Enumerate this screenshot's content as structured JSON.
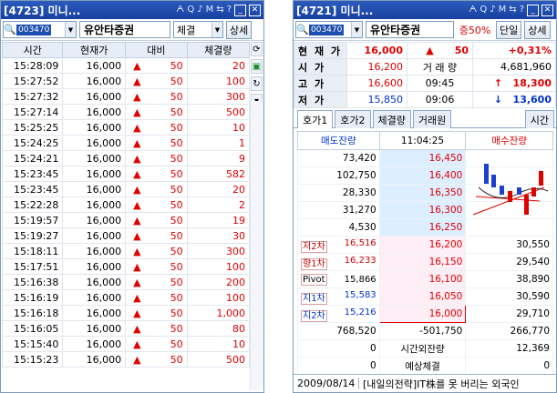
{
  "w1": {
    "title": "[4723] 미니...",
    "code": "003470",
    "name": "유안타증권",
    "type": "체결",
    "detail": "상세",
    "headers": [
      "시간",
      "현재가",
      "대비",
      "체결량"
    ],
    "rows": [
      [
        "15:28:09",
        "16,000",
        "50",
        "20"
      ],
      [
        "15:27:52",
        "16,000",
        "50",
        "100"
      ],
      [
        "15:27:32",
        "16,000",
        "50",
        "300"
      ],
      [
        "15:27:14",
        "16,000",
        "50",
        "500"
      ],
      [
        "15:25:25",
        "16,000",
        "50",
        "10"
      ],
      [
        "15:24:25",
        "16,000",
        "50",
        "1"
      ],
      [
        "15:24:21",
        "16,000",
        "50",
        "9"
      ],
      [
        "15:23:45",
        "16,000",
        "50",
        "582"
      ],
      [
        "15:23:45",
        "16,000",
        "50",
        "20"
      ],
      [
        "15:22:28",
        "16,000",
        "50",
        "2"
      ],
      [
        "15:19:57",
        "16,000",
        "50",
        "19"
      ],
      [
        "15:19:27",
        "16,000",
        "50",
        "30"
      ],
      [
        "15:18:11",
        "16,000",
        "50",
        "300"
      ],
      [
        "15:17:51",
        "16,000",
        "50",
        "100"
      ],
      [
        "15:16:38",
        "16,000",
        "50",
        "200"
      ],
      [
        "15:16:19",
        "16,000",
        "50",
        "100"
      ],
      [
        "15:16:18",
        "16,000",
        "50",
        "1,000"
      ],
      [
        "15:16:05",
        "16,000",
        "50",
        "80"
      ],
      [
        "15:15:40",
        "16,000",
        "50",
        "10"
      ],
      [
        "15:15:23",
        "16,000",
        "50",
        "500"
      ]
    ]
  },
  "w2": {
    "title": "[4721] 미니...",
    "code": "003470",
    "name": "유안타증권",
    "margin": "증50%",
    "unit": "단일",
    "detail": "상세",
    "quote": {
      "cur_label": "현 재 가",
      "cur": "16,000",
      "chg": "50",
      "pct": "+0,31%",
      "open_label": "시  가",
      "open": "16,200",
      "vol_label": "거 래 량",
      "vol": "4,681,960",
      "high_label": "고  가",
      "high": "16,600",
      "high_t": "09:45",
      "high_p": "18,300",
      "low_label": "저  가",
      "low": "15,850",
      "low_t": "09:06",
      "low_p": "13,600"
    },
    "tabs": [
      "호가1",
      "호가2",
      "체결량",
      "거래원"
    ],
    "time_tab": "시간",
    "ob": {
      "sell_h": "매도잔량",
      "time": "11:04:25",
      "buy_h": "매수잔량",
      "asks": [
        [
          "73,420",
          "16,450"
        ],
        [
          "102,750",
          "16,400"
        ],
        [
          "28,330",
          "16,350"
        ],
        [
          "31,270",
          "16,300"
        ],
        [
          "4,530",
          "16,250"
        ]
      ],
      "levels": [
        [
          "저2차",
          "16,516"
        ],
        [
          "향1차",
          "16,233"
        ],
        [
          "Pivot",
          "15,866"
        ],
        [
          "지1차",
          "15,583"
        ],
        [
          "지2차",
          "15,216"
        ]
      ],
      "bids": [
        [
          "16,200",
          "30,550"
        ],
        [
          "16,150",
          "29,540"
        ],
        [
          "16,100",
          "38,890"
        ],
        [
          "16,050",
          "30,590"
        ],
        [
          "16,000",
          "29,710"
        ]
      ],
      "tot_sell": "768,520",
      "tot_diff": "-501,750",
      "tot_buy": "266,770",
      "ext_l": "0",
      "ext_label": "시간외잔량",
      "ext_r": "12,369",
      "exp_l": "0",
      "exp_label": "예상체결",
      "exp_r": "0"
    },
    "date": "2009/08/14",
    "news": "[내일의전략]IT株를 못 버리는 외국인"
  }
}
